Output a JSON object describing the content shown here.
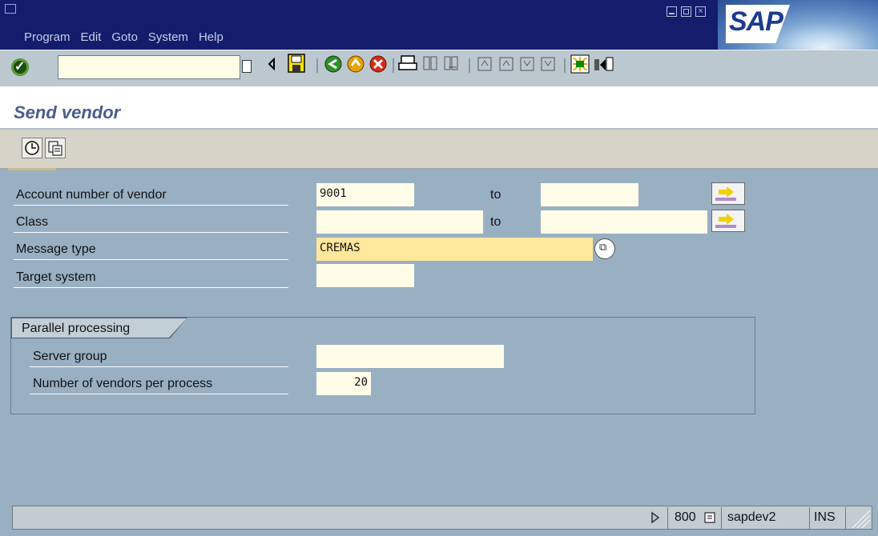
{
  "menu": [
    "Program",
    "Edit",
    "Goto",
    "System",
    "Help"
  ],
  "logo_text": "SAP",
  "title": "Send vendor",
  "form": {
    "rows": [
      {
        "label": "Account number of vendor",
        "value": "9001",
        "to_label": "to",
        "to_value": ""
      },
      {
        "label": "Class",
        "value": "",
        "to_label": "to",
        "to_value": ""
      },
      {
        "label": "Message type",
        "value": "CREMAS"
      },
      {
        "label": "Target system",
        "value": ""
      }
    ]
  },
  "group": {
    "title": "Parallel processing",
    "rows": [
      {
        "label": "Server group",
        "value": ""
      },
      {
        "label": "Number of vendors per process",
        "value": "20"
      }
    ]
  },
  "status": {
    "client": "800",
    "system": "sapdev2",
    "mode": "INS"
  },
  "icons": [
    "enter-icon",
    "command-dropdown-icon",
    "back-arrow-icon",
    "save-icon",
    "back-icon",
    "exit-icon",
    "cancel-icon",
    "print-icon",
    "find-icon",
    "find-next-icon",
    "first-page-icon",
    "previous-page-icon",
    "next-page-icon",
    "last-page-icon",
    "create-session-icon",
    "generate-shortcut-icon",
    "execute-icon",
    "get-variant-icon",
    "multiple-selection-icon",
    "possible-entries-icon"
  ],
  "colors": {
    "title_bar": "#141c6c",
    "screen_bg": "#99b0c3",
    "required_field": "#ffe79b",
    "title_text": "#4a5c8e"
  }
}
